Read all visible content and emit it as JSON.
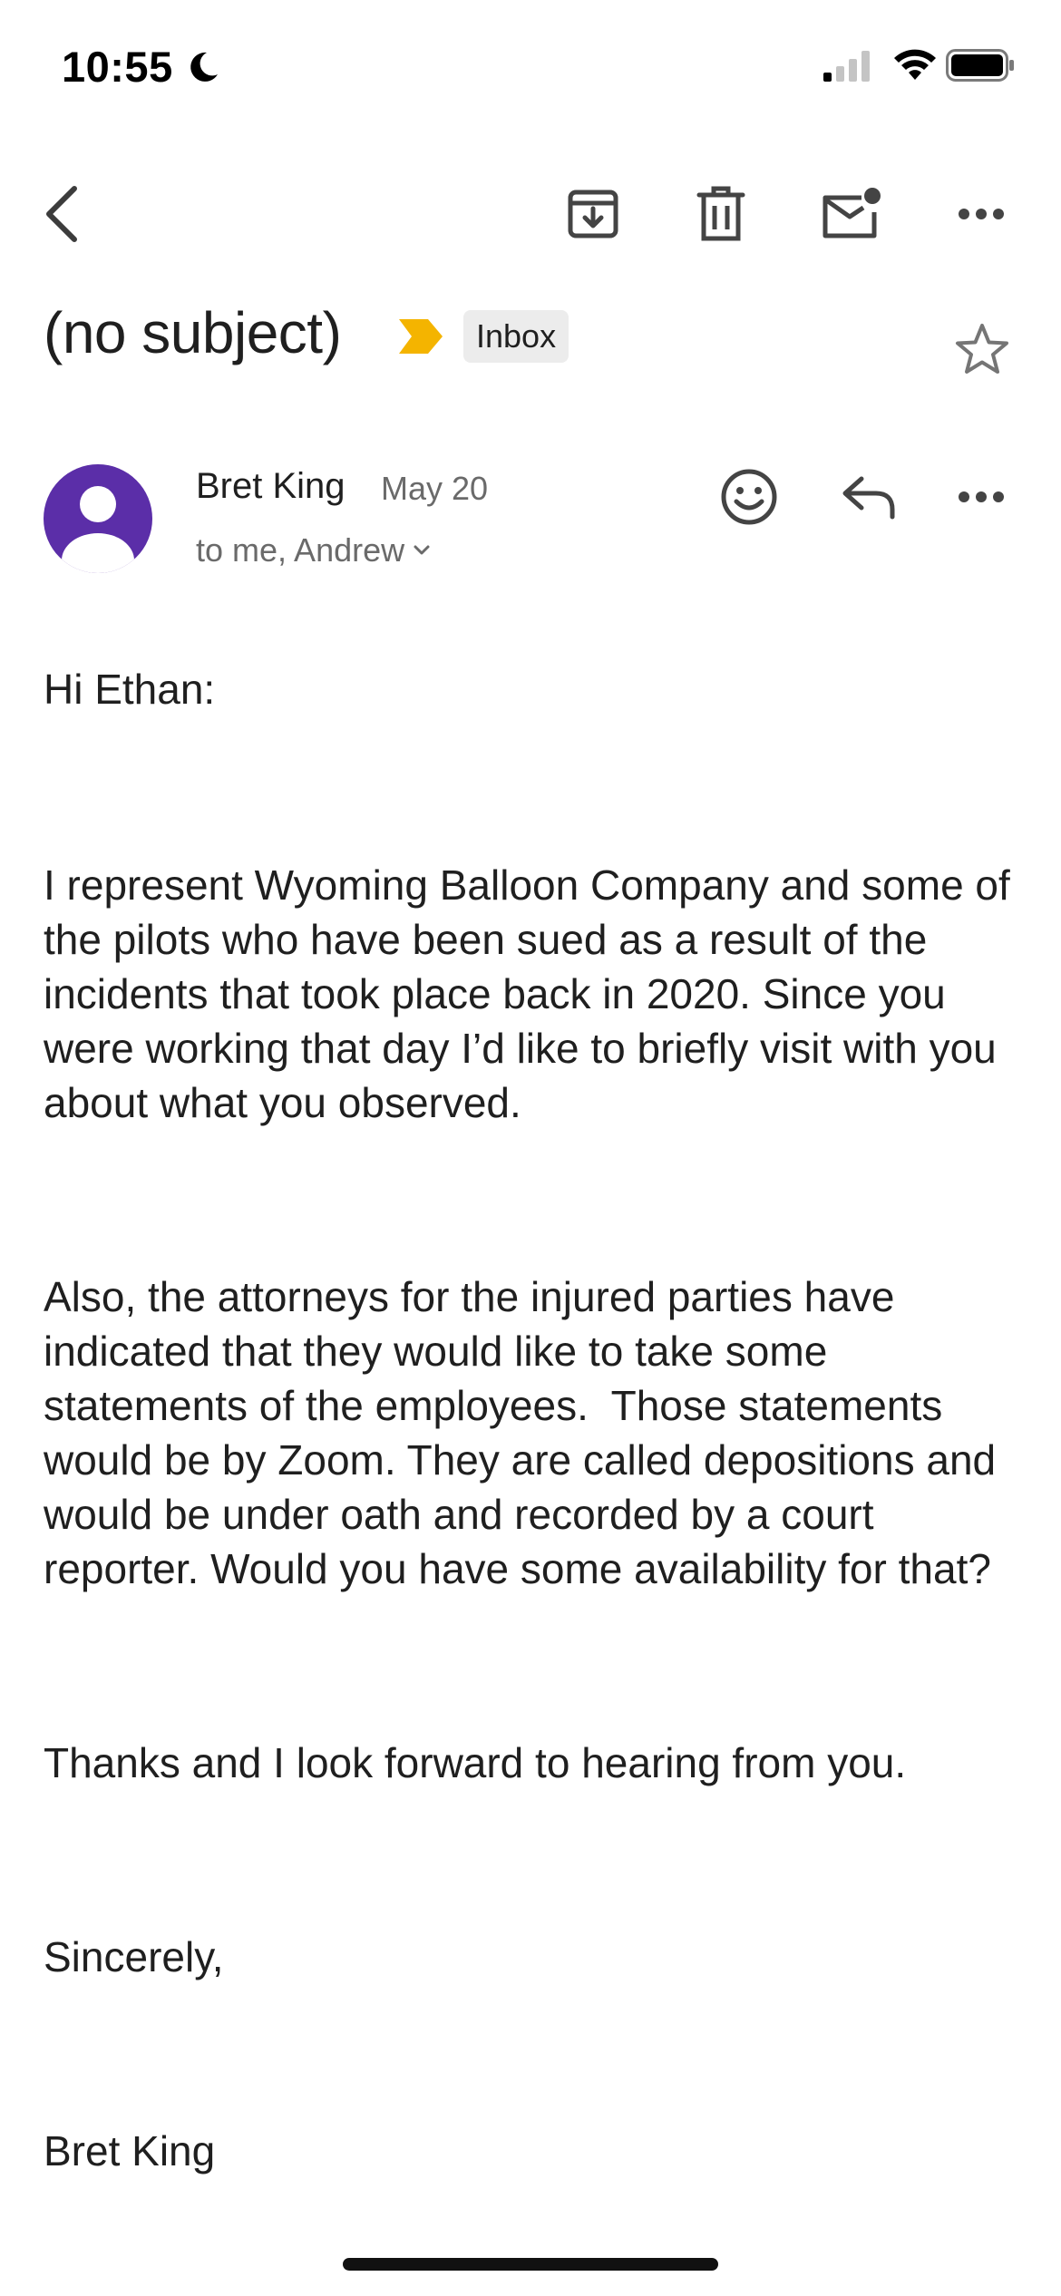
{
  "status_bar": {
    "time": "10:55",
    "icons": [
      "moon-icon",
      "cellular-signal-icon",
      "wifi-icon",
      "battery-icon"
    ]
  },
  "toolbar": {
    "back": "back-arrow-icon",
    "actions": [
      "archive-icon",
      "delete-icon",
      "mark-unread-icon",
      "more-icon"
    ]
  },
  "email": {
    "subject": "(no subject)",
    "label": "Inbox",
    "importance_color": "#f4b400",
    "sender": {
      "name": "Bret King",
      "date": "May 20",
      "recipients": "to me, Andrew",
      "avatar_color": "#5b2ea8"
    },
    "body": {
      "greeting": "Hi Ethan:",
      "p1": "I represent Wyoming Balloon Company and some of the pilots who have been sued as a result of the incidents that took place back in 2020. Since you were working that day I’d like to briefly visit with you about what you observed.",
      "p2": "Also, the attorneys for the injured parties have indicated that they would like to take some statements of the employees.  Those statements would be by Zoom. They are called depositions and would be under oath and recorded by a court reporter. Would you have some availability for that?",
      "p3": "Thanks and I look forward to hearing from you.",
      "closing": "Sincerely,",
      "signature": "Bret King"
    }
  }
}
